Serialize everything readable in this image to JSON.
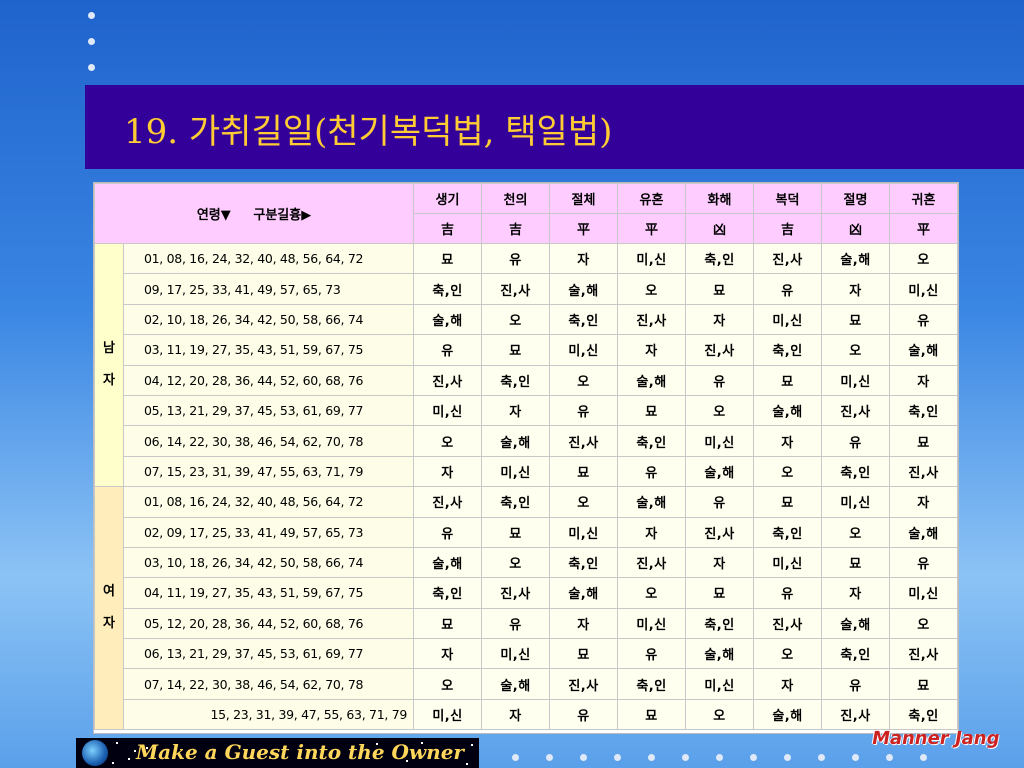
{
  "title": "19. 가취길일(천기복덕법, 택일법)",
  "header": {
    "left_label": "연령▼     구분길흉▶",
    "columns": [
      "생기",
      "천의",
      "절체",
      "유혼",
      "화해",
      "복덕",
      "절명",
      "귀혼"
    ],
    "sub": [
      "吉",
      "吉",
      "平",
      "平",
      "凶",
      "吉",
      "凶",
      "平"
    ]
  },
  "groups": {
    "male": "남\n자",
    "female": "여\n자"
  },
  "rows_male": [
    {
      "age": "01, 08, 16, 24, 32, 40, 48, 56, 64, 72",
      "cells": [
        "묘",
        "유",
        "자",
        "미,신",
        "축,인",
        "진,사",
        "술,해",
        "오"
      ]
    },
    {
      "age": "09, 17, 25, 33, 41, 49, 57, 65, 73",
      "cells": [
        "축,인",
        "진,사",
        "술,해",
        "오",
        "묘",
        "유",
        "자",
        "미,신"
      ]
    },
    {
      "age": "02, 10, 18, 26, 34, 42, 50, 58, 66, 74",
      "cells": [
        "술,해",
        "오",
        "축,인",
        "진,사",
        "자",
        "미,신",
        "묘",
        "유"
      ]
    },
    {
      "age": "03, 11, 19, 27, 35, 43, 51, 59, 67, 75",
      "cells": [
        "유",
        "묘",
        "미,신",
        "자",
        "진,사",
        "축,인",
        "오",
        "술,해"
      ]
    },
    {
      "age": "04, 12, 20, 28, 36, 44, 52, 60, 68, 76",
      "cells": [
        "진,사",
        "축,인",
        "오",
        "술,해",
        "유",
        "묘",
        "미,신",
        "자"
      ]
    },
    {
      "age": "05, 13, 21, 29, 37, 45, 53, 61, 69, 77",
      "cells": [
        "미,신",
        "자",
        "유",
        "묘",
        "오",
        "술,해",
        "진,사",
        "축,인"
      ]
    },
    {
      "age": "06, 14, 22, 30, 38, 46, 54, 62, 70, 78",
      "cells": [
        "오",
        "술,해",
        "진,사",
        "축,인",
        "미,신",
        "자",
        "유",
        "묘"
      ]
    },
    {
      "age": "07, 15, 23, 31, 39, 47, 55, 63, 71, 79",
      "cells": [
        "자",
        "미,신",
        "묘",
        "유",
        "술,해",
        "오",
        "축,인",
        "진,사"
      ]
    }
  ],
  "rows_female": [
    {
      "age": "01, 08, 16, 24, 32, 40, 48, 56, 64, 72",
      "cells": [
        "진,사",
        "축,인",
        "오",
        "술,해",
        "유",
        "묘",
        "미,신",
        "자"
      ]
    },
    {
      "age": "02, 09, 17, 25, 33, 41, 49, 57, 65, 73",
      "cells": [
        "유",
        "묘",
        "미,신",
        "자",
        "진,사",
        "축,인",
        "오",
        "술,해"
      ]
    },
    {
      "age": "03, 10, 18, 26, 34, 42, 50, 58, 66, 74",
      "cells": [
        "술,해",
        "오",
        "축,인",
        "진,사",
        "자",
        "미,신",
        "묘",
        "유"
      ]
    },
    {
      "age": "04, 11, 19, 27, 35, 43, 51, 59, 67, 75",
      "cells": [
        "축,인",
        "진,사",
        "술,해",
        "오",
        "묘",
        "유",
        "자",
        "미,신"
      ]
    },
    {
      "age": "05, 12, 20, 28, 36, 44, 52, 60, 68, 76",
      "cells": [
        "묘",
        "유",
        "자",
        "미,신",
        "축,인",
        "진,사",
        "술,해",
        "오"
      ]
    },
    {
      "age": "06, 13, 21, 29, 37, 45, 53, 61, 69, 77",
      "cells": [
        "자",
        "미,신",
        "묘",
        "유",
        "술,해",
        "오",
        "축,인",
        "진,사"
      ]
    },
    {
      "age": "07, 14, 22, 30, 38, 46, 54, 62, 70, 78",
      "cells": [
        "오",
        "술,해",
        "진,사",
        "축,인",
        "미,신",
        "자",
        "유",
        "묘"
      ]
    },
    {
      "age": "15, 23, 31, 39, 47, 55, 63, 71, 79",
      "cells": [
        "미,신",
        "자",
        "유",
        "묘",
        "오",
        "술,해",
        "진,사",
        "축,인"
      ]
    }
  ],
  "footer": {
    "slogan": "Make a Guest into the Owner",
    "brand": "Manner Jang",
    "icon": "globe-icon"
  },
  "colors": {
    "title_bar": "#330099",
    "title_text": "#ffcc33",
    "header_bg": "#ffccff",
    "male_bg": "#ffffcc",
    "female_bg": "#ffeebb"
  }
}
